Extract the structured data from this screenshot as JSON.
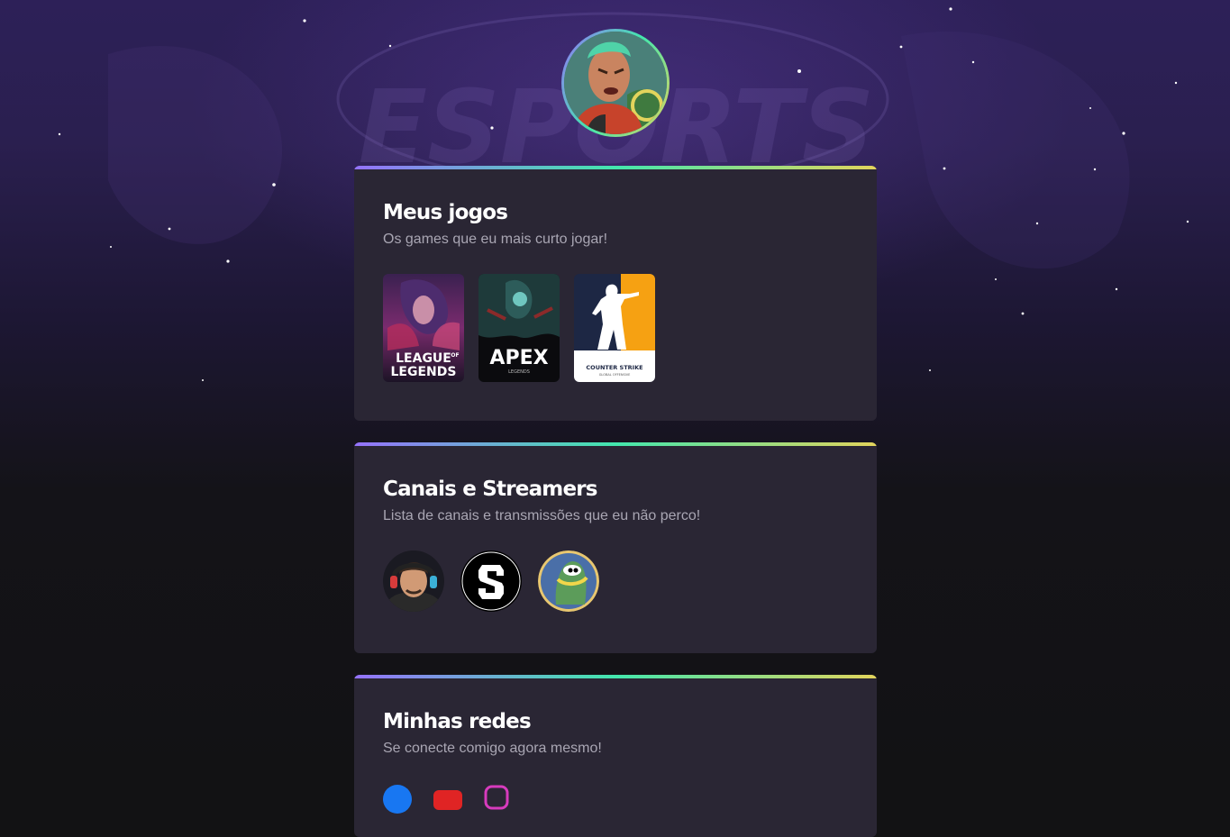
{
  "profile": {
    "avatar_icon": "character-avatar-icon"
  },
  "background": {
    "watermark_text": "ESPORTS"
  },
  "games_card": {
    "title": "Meus jogos",
    "subtitle": "Os games que eu mais curto jogar!",
    "games": [
      {
        "name": "League of Legends",
        "logo_line1": "LEAGUE",
        "logo_of": "OF",
        "logo_line2": "LEGENDS"
      },
      {
        "name": "Apex Legends",
        "logo_line1": "APEX",
        "logo_line2": "LEGENDS"
      },
      {
        "name": "Counter-Strike",
        "logo_line1": "COUNTER STRIKE",
        "logo_line2": "GLOBAL OFFENSIVE"
      }
    ]
  },
  "streamers_card": {
    "title": "Canais e Streamers",
    "subtitle": "Lista de canais e transmissões que eu não perco!",
    "streamers": [
      {
        "icon": "streamer-photo-icon"
      },
      {
        "icon": "streamer-logo-icon"
      },
      {
        "icon": "streamer-cartoon-icon"
      }
    ]
  },
  "socials_card": {
    "title": "Minhas redes",
    "subtitle": "Se conecte comigo agora mesmo!",
    "icons": [
      "facebook-icon",
      "youtube-icon",
      "instagram-icon"
    ]
  },
  "colors": {
    "gradient_start": "#9572fc",
    "gradient_mid": "#43e7ad",
    "gradient_end": "#e2d45c",
    "card_bg": "#2a2634",
    "page_bg": "#121214"
  }
}
